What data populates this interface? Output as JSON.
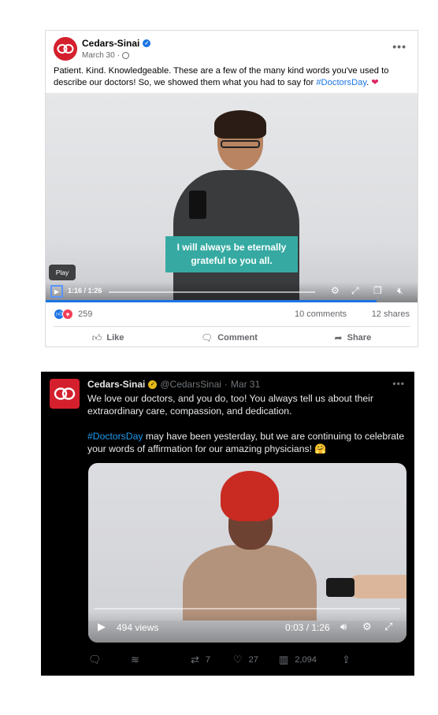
{
  "facebook": {
    "page_name": "Cedars-Sinai",
    "date": "March 30",
    "date_separator": "·",
    "more_label": "•••",
    "post_text_main": "Patient. Kind. Knowledgeable. These are a few of the many kind words you've used to describe our doctors! So, we showed them what you had to say for ",
    "hashtag": "#DoctorsDay",
    "post_text_end": ". ",
    "heart": "❤",
    "video": {
      "caption_line1": "I will always be eternally",
      "caption_line2": "grateful to you all.",
      "tooltip": "Play",
      "time": "1:16 / 1:26",
      "progress_fraction": 0.89
    },
    "reactions_count": "259",
    "comments": "10 comments",
    "shares": "12 shares",
    "actions": {
      "like": "Like",
      "comment": "Comment",
      "share": "Share"
    },
    "colors": {
      "accent": "#1b74e4",
      "brand": "#d4202d",
      "caption_bg": "#36aaa2"
    }
  },
  "twitter": {
    "name": "Cedars-Sinai",
    "handle": "@CedarsSinai",
    "date_separator": "·",
    "date": "Mar 31",
    "more_label": "•••",
    "text_p1": "We love our doctors, and you do, too! You always tell us about their extraordinary care, compassion, and dedication.",
    "hashtag": "#DoctorsDay",
    "text_p2": " may have been yesterday, but we are continuing to celebrate your words of affirmation for our amazing physicians! ",
    "emoji": "🤗",
    "video": {
      "views": "494 views",
      "time": "0:03 / 1:26"
    },
    "actions": {
      "retweets": "7",
      "likes": "27",
      "views": "2,094"
    },
    "colors": {
      "accent": "#1d9bf0",
      "gold_badge": "#e2b719"
    }
  }
}
